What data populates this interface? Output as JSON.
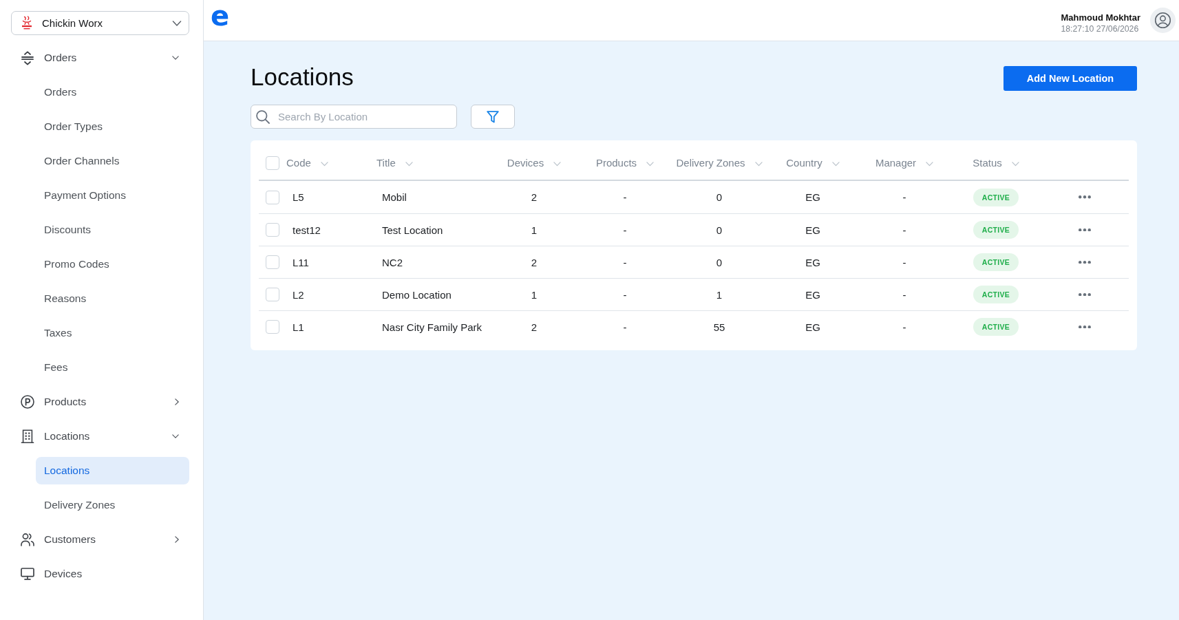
{
  "brand_selector": {
    "name": "Chickin Worx"
  },
  "sidebar": {
    "items": [
      {
        "kind": "group",
        "label": "Orders",
        "expanded": true,
        "children": [
          {
            "label": "Orders",
            "selected": false
          },
          {
            "label": "Order Types",
            "selected": false
          },
          {
            "label": "Order Channels",
            "selected": false
          },
          {
            "label": "Payment Options",
            "selected": false
          },
          {
            "label": "Discounts",
            "selected": false
          },
          {
            "label": "Promo Codes",
            "selected": false
          },
          {
            "label": "Reasons",
            "selected": false
          },
          {
            "label": "Taxes",
            "selected": false
          },
          {
            "label": "Fees",
            "selected": false
          }
        ]
      },
      {
        "kind": "group",
        "label": "Products",
        "expanded": false
      },
      {
        "kind": "group",
        "label": "Locations",
        "expanded": true,
        "children": [
          {
            "label": "Locations",
            "selected": true
          },
          {
            "label": "Delivery Zones",
            "selected": false
          }
        ]
      },
      {
        "kind": "group",
        "label": "Customers",
        "expanded": false
      },
      {
        "kind": "link",
        "label": "Devices",
        "selected": false
      }
    ]
  },
  "top_bar": {
    "app_logo": "e",
    "user": {
      "name": "Mahmoud Mokhtar",
      "timestamp": "18:27:10 27/06/2026"
    }
  },
  "page": {
    "title": "Locations",
    "primary_button": "Add New Location",
    "search": {
      "placeholder": "Search By Location"
    },
    "table": {
      "all_selected": false,
      "columns": [
        "Code",
        "Title",
        "Devices",
        "Products",
        "Delivery Zones",
        "Country",
        "Manager",
        "Status"
      ],
      "rows": [
        {
          "selected": false,
          "cells": [
            "L5",
            "Mobil",
            "2",
            "-",
            "0",
            "EG",
            "-"
          ],
          "status": "ACTIVE"
        },
        {
          "selected": false,
          "cells": [
            "test12",
            "Test Location",
            "1",
            "-",
            "0",
            "EG",
            "-"
          ],
          "status": "ACTIVE"
        },
        {
          "selected": false,
          "cells": [
            "L11",
            "NC2",
            "2",
            "-",
            "0",
            "EG",
            "-"
          ],
          "status": "ACTIVE"
        },
        {
          "selected": false,
          "cells": [
            "L2",
            "Demo Location",
            "1",
            "-",
            "1",
            "EG",
            "-"
          ],
          "status": "ACTIVE"
        },
        {
          "selected": false,
          "cells": [
            "L1",
            "Nasr City Family Park",
            "2",
            "-",
            "55",
            "EG",
            "-"
          ],
          "status": "ACTIVE"
        }
      ]
    }
  }
}
